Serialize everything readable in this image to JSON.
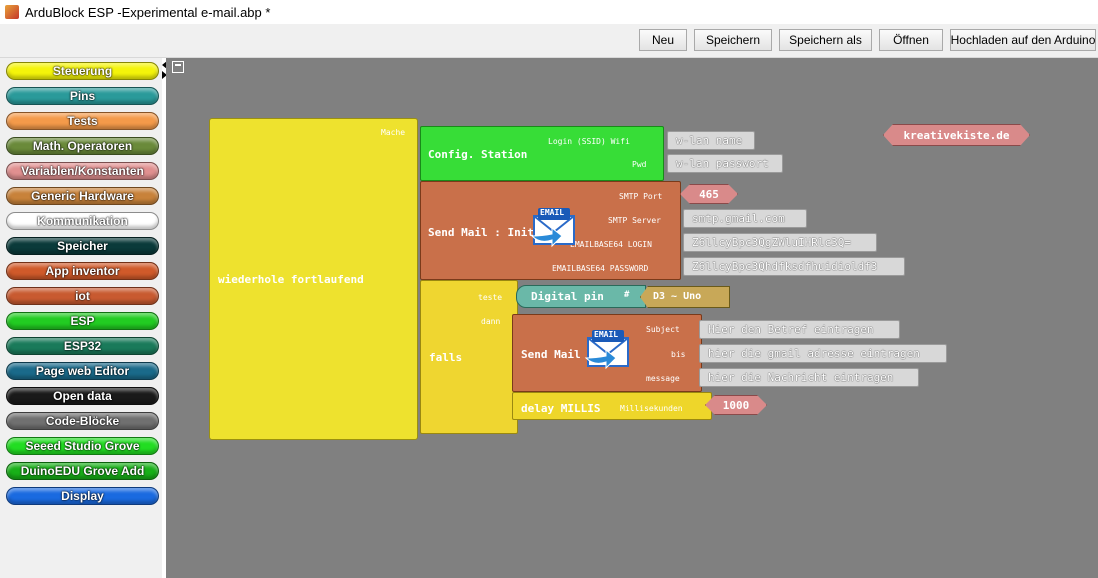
{
  "window": {
    "title": "ArduBlock ESP -Experimental e-mail.abp *"
  },
  "toolbar": {
    "buttons": [
      {
        "label": "Neu"
      },
      {
        "label": "Speichern"
      },
      {
        "label": "Speichern als"
      },
      {
        "label": "Öffnen"
      },
      {
        "label": "Hochladen auf den Arduino"
      }
    ]
  },
  "palette": {
    "categories": [
      {
        "label": "Steuerung",
        "color": "#f4f40a"
      },
      {
        "label": "Pins",
        "color": "#2a9a9a"
      },
      {
        "label": "Tests",
        "color": "#f49a4a"
      },
      {
        "label": "Math. Operatoren",
        "color": "#6a8a3a"
      },
      {
        "label": "Variablen/Konstanten",
        "color": "#e09090"
      },
      {
        "label": "Generic Hardware",
        "color": "#c8823a"
      },
      {
        "label": "Kommunikation",
        "color": "#ffffff"
      },
      {
        "label": "Speicher",
        "color": "#0a3a3a"
      },
      {
        "label": "App inventor",
        "color": "#d05a2a"
      },
      {
        "label": "iot",
        "color": "#c85a30"
      },
      {
        "label": "ESP",
        "color": "#22cc22"
      },
      {
        "label": "ESP32",
        "color": "#1a7a5a"
      },
      {
        "label": "Page web Editor",
        "color": "#1a6a8a"
      },
      {
        "label": "Open data",
        "color": "#1a1a1a"
      },
      {
        "label": "Code-Blöcke",
        "color": "#707070"
      },
      {
        "label": "Seeed Studio Grove",
        "color": "#22dd22"
      },
      {
        "label": "DuinoEDU Grove Add",
        "color": "#18b018"
      },
      {
        "label": "Display",
        "color": "#1a6ae0"
      }
    ]
  },
  "blocks": {
    "loop": {
      "label": "wiederhole fortlaufend",
      "socket": "Mache"
    },
    "config": {
      "label": "Config. Station",
      "ssid_label": "Login (SSID) Wifi",
      "ssid_value": "w-lan name",
      "pwd_label": "Pwd",
      "pwd_value": "w-lan passwort"
    },
    "sendinit": {
      "label": "Send Mail : Init",
      "icon_text": "EMAIL",
      "port_label": "SMTP Port",
      "port_value": "465",
      "server_label": "SMTP Server",
      "server_value": "smtp.gmail.com",
      "login_label": "EMAILBASE64 LOGIN",
      "login_value": "Z6llcyBpc3QgZWluIHRlc3Q=",
      "pass_label": "EMAILBASE64 PASSWORD",
      "pass_value": "Z6llcyBpc3Qhdfksdfhuidioldf3"
    },
    "falls": {
      "label": "falls",
      "test_label": "teste",
      "then_label": "dann"
    },
    "digitalpin": {
      "label": "Digital pin",
      "hash": "#",
      "pin": "D3 ~ Uno"
    },
    "sendmail": {
      "label": "Send Mail : Send",
      "icon_text": "EMAIL",
      "subject_label": "Subject",
      "subject_value": "Hier den Betref eintragen",
      "to_label": "bis",
      "to_value": "hier die gmail adresse eintragen",
      "msg_label": "message",
      "msg_value": "hier die Nachricht eintragen"
    },
    "delay": {
      "label": "delay MILLIS",
      "ms_label": "Millisekunden",
      "ms_value": "1000"
    },
    "comment": {
      "label": "kreativekiste.de"
    }
  }
}
